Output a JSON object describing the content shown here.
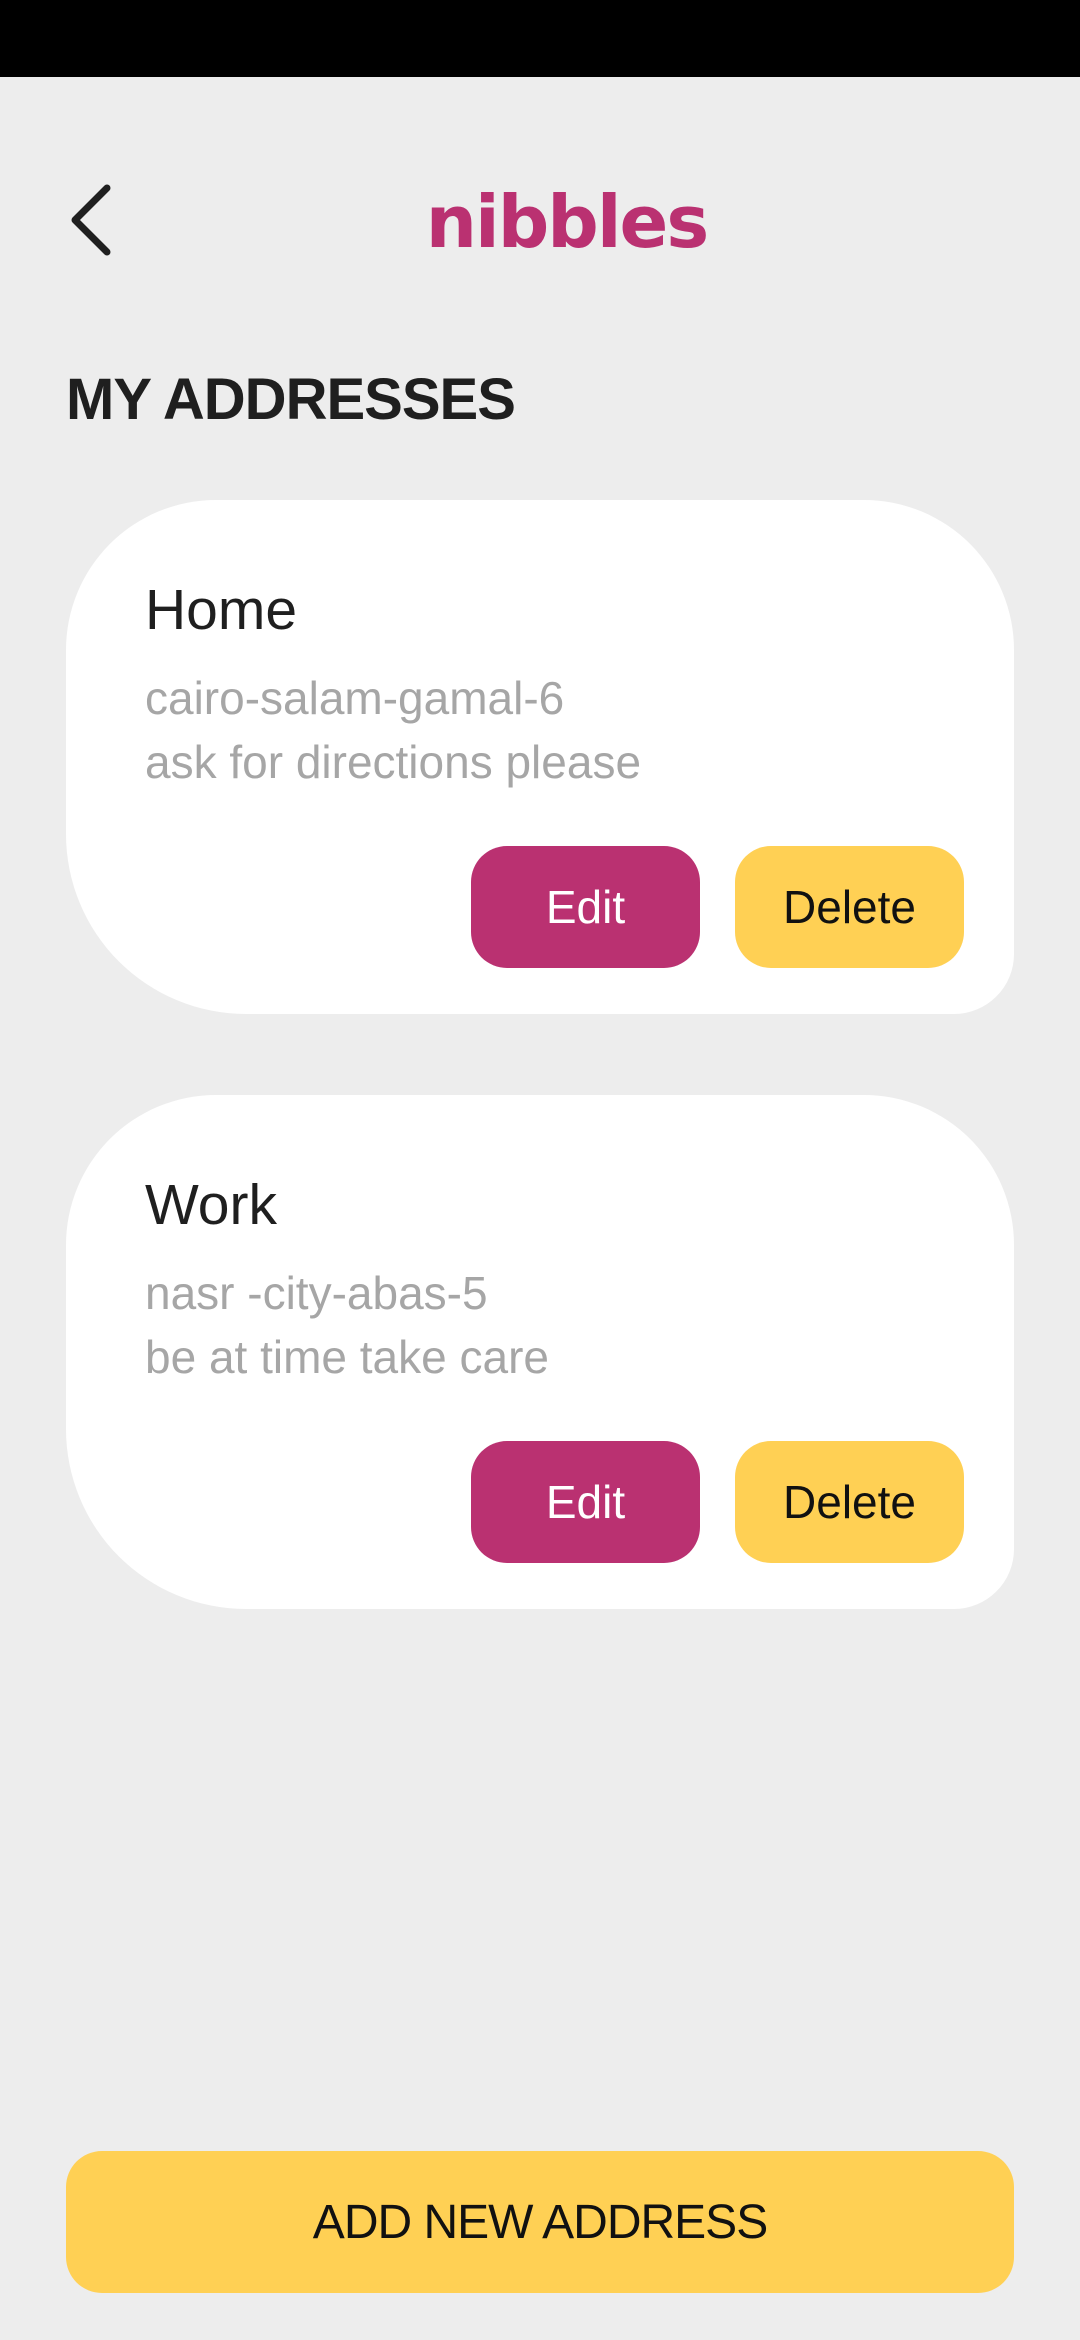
{
  "header": {
    "back_icon": "chevron-left-icon",
    "brand": "nibbles",
    "brand_color": "#ba3171"
  },
  "page": {
    "title": "MY ADDRESSES"
  },
  "addresses": [
    {
      "label": "Home",
      "line1": "cairo-salam-gamal-6",
      "line2": "ask for directions please",
      "edit_label": "Edit",
      "delete_label": "Delete"
    },
    {
      "label": "Work",
      "line1": "nasr -city-abas-5",
      "line2": "be at time take care",
      "edit_label": "Edit",
      "delete_label": "Delete"
    }
  ],
  "footer": {
    "add_label": "ADD NEW ADDRESS"
  },
  "colors": {
    "background": "#ededed",
    "primary": "#ba3171",
    "accent": "#ffd054",
    "card": "#ffffff",
    "muted_text": "#a6a6a6"
  }
}
